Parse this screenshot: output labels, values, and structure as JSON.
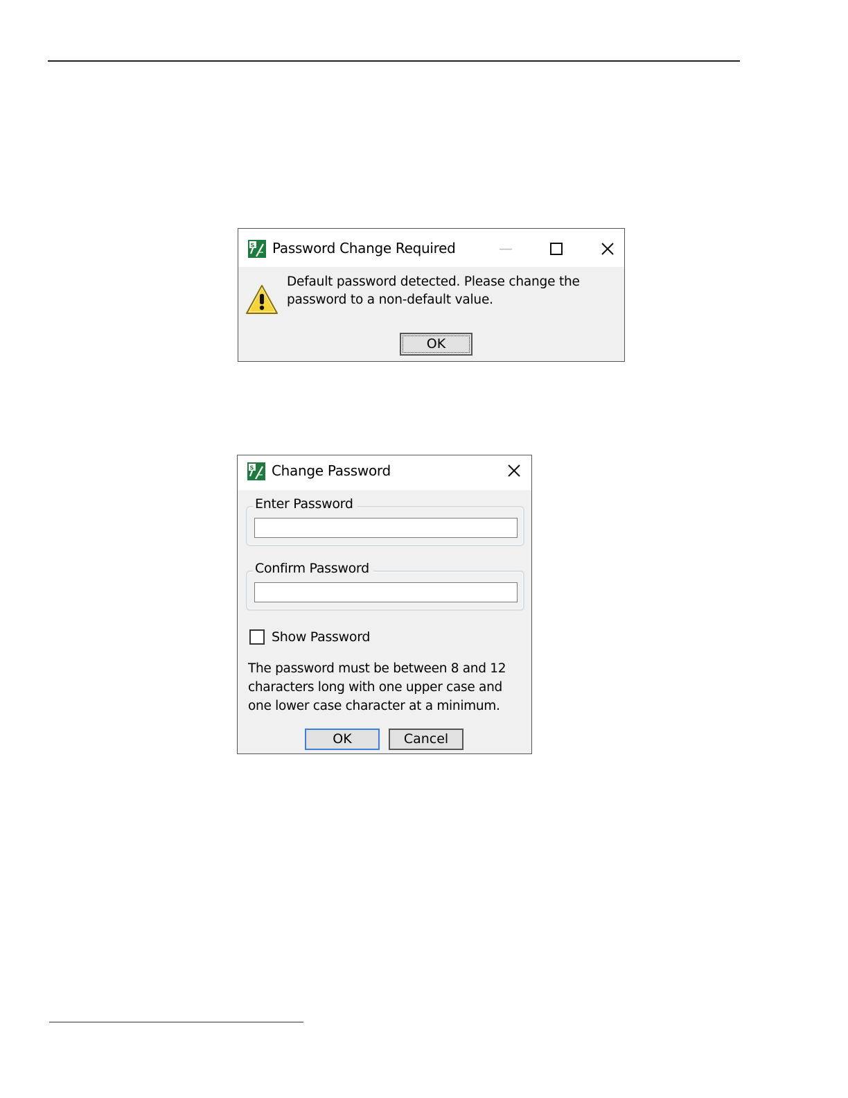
{
  "dialog_required": {
    "title": "Password Change Required",
    "message": "Default password detected. Please change the password to a non-default value.",
    "ok_label": "OK"
  },
  "dialog_change": {
    "title": "Change Password",
    "enter_label": "Enter Password",
    "enter_value": "",
    "confirm_label": "Confirm Password",
    "confirm_value": "",
    "show_password_label": "Show Password",
    "show_password_checked": false,
    "help_text": "The password must be between 8 and 12 characters long with one upper case and one lower case character at a minimum.",
    "ok_label": "OK",
    "cancel_label": "Cancel"
  },
  "icons": {
    "app": "app-logo-icon",
    "warning": "warning-icon",
    "minimize": "minimize-icon",
    "maximize": "maximize-icon",
    "close": "close-icon"
  },
  "colors": {
    "app_icon_green": "#1f7a3f",
    "warning_yellow": "#f5d33a",
    "default_button_border": "#3c7fd8",
    "dialog_bg": "#f0f0f0"
  }
}
